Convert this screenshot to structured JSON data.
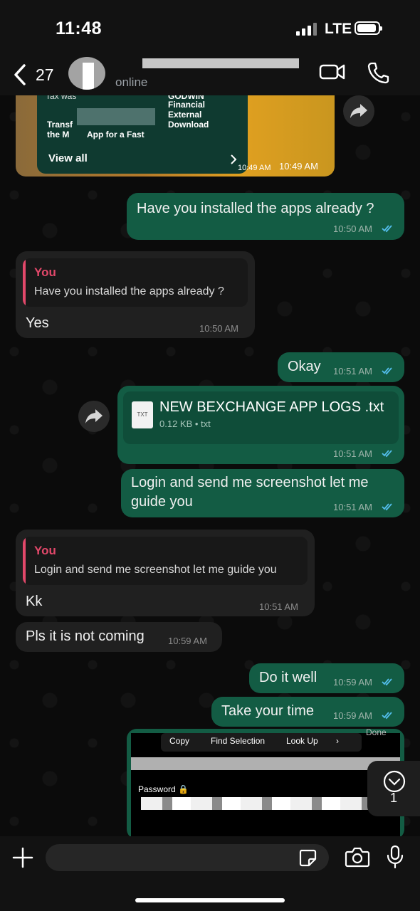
{
  "status_bar": {
    "time": "11:48",
    "network": "LTE"
  },
  "header": {
    "back_count": "27",
    "status": "online"
  },
  "top_card": {
    "snippet_1": "Tax was",
    "snippet_2": "GODWIN",
    "snippet_3": "Financial",
    "snippet_4": "External",
    "snippet_5": "Download",
    "snippet_6": "Transf",
    "snippet_7": "App for a Fast",
    "snippet_8": "the M",
    "view_all": "View all",
    "time_1": "10:49 AM",
    "time_2": "10:49 AM"
  },
  "messages": [
    {
      "text": "Have you installed the apps already ?",
      "time": "10:50 AM"
    },
    {
      "quote_author": "You",
      "quote_text": "Have you installed the apps already ?",
      "text": "Yes",
      "time": "10:50 AM"
    },
    {
      "text": "Okay",
      "time": "10:51 AM"
    },
    {
      "file_name": "NEW BEXCHANGE APP LOGS .txt",
      "file_meta": "0.12 KB • txt",
      "file_icon_label": "TXT",
      "time": "10:51 AM"
    },
    {
      "text_line1": "Login and send me screenshot let me",
      "text_line2": "guide you",
      "time": "10:51 AM"
    },
    {
      "quote_author": "You",
      "quote_text": "Login and send me screenshot let me guide you",
      "text": "Kk",
      "time": "10:51 AM"
    },
    {
      "text": "Pls it is not coming",
      "time": "10:59 AM"
    },
    {
      "text": "Do it well",
      "time": "10:59 AM"
    },
    {
      "text": "Take your time",
      "time": "10:59 AM"
    }
  ],
  "screenshot_preview": {
    "menu": [
      "Copy",
      "Find Selection",
      "Look Up",
      "›"
    ],
    "label": "Password 🔒",
    "done": "Done"
  },
  "scroll_badge": "1",
  "colors": {
    "outgoing": "#135c44",
    "incoming": "#202020",
    "quote_accent": "#e2486a",
    "ticks": "#53bdeb"
  }
}
